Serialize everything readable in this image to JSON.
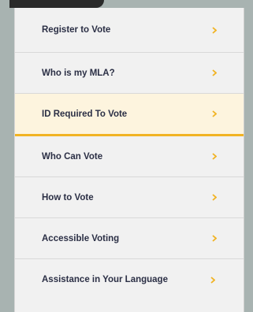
{
  "menu": {
    "items": [
      {
        "label": "Register to Vote",
        "icon": "chevron-right-icon",
        "active": false
      },
      {
        "label": "Who is my MLA?",
        "icon": "chevron-right-icon",
        "active": false
      },
      {
        "label": "ID Required To Vote",
        "icon": "chevron-right-icon",
        "active": true
      },
      {
        "label": "Who Can Vote",
        "icon": "chevron-right-icon",
        "active": false
      },
      {
        "label": "How to Vote",
        "icon": "chevron-right-icon",
        "active": false
      },
      {
        "label": "Accessible Voting",
        "icon": "chevron-right-icon",
        "active": false
      },
      {
        "label": "Assistance in Your Language",
        "icon": "chevron-right-icon",
        "active": false
      }
    ]
  },
  "colors": {
    "background": "#a8b3b1",
    "panel": "#f1f1f1",
    "active_bg": "#fdf4de",
    "accent": "#f1b323",
    "text": "#2b2f45"
  }
}
